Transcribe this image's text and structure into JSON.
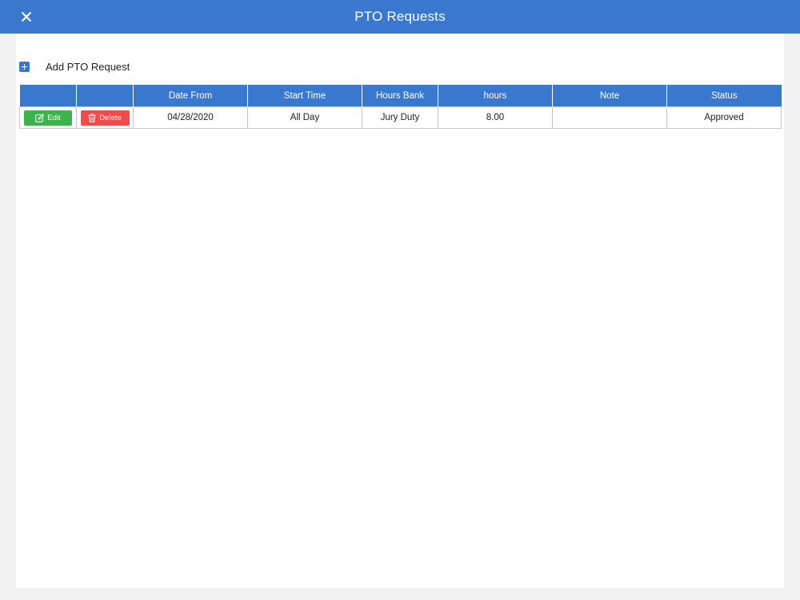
{
  "header": {
    "title": "PTO Requests",
    "close_icon": "close-icon"
  },
  "actions": {
    "add_label": "Add PTO Request",
    "add_icon": "plus-icon"
  },
  "table": {
    "columns": [
      "",
      "",
      "Date From",
      "Start Time",
      "Hours Bank",
      "hours",
      "Note",
      "Status"
    ],
    "rows": [
      {
        "edit_label": "Edit",
        "delete_label": "Delete",
        "date_from": "04/28/2020",
        "start_time": "All Day",
        "hours_bank": "Jury Duty",
        "hours": "8.00",
        "note": "",
        "status": "Approved"
      }
    ]
  },
  "colors": {
    "header_bg": "#3a78d0",
    "edit_button": "#3cb44b",
    "delete_button": "#f04c4c",
    "page_bg": "#f2f2f2"
  }
}
